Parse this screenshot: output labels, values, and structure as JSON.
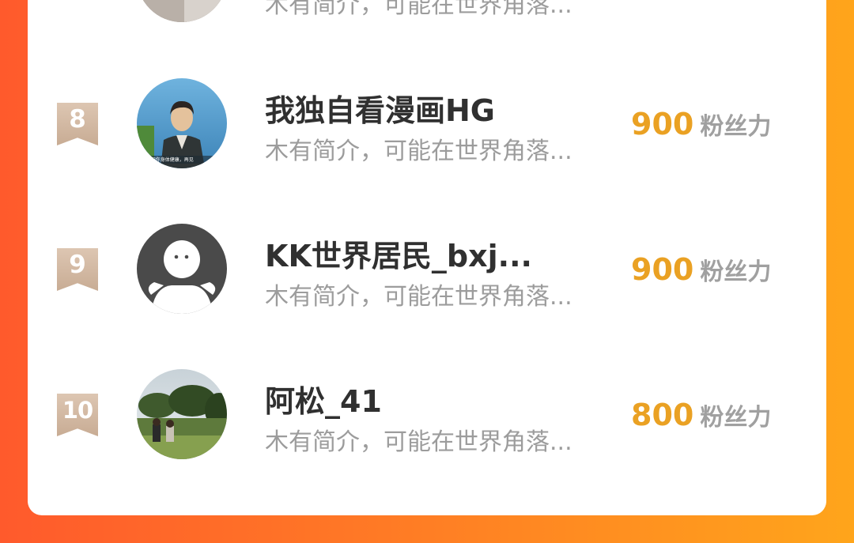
{
  "colors": {
    "accent_gradient_left": "#ff5a2c",
    "accent_gradient_right": "#ffa51b",
    "score": "#eaa123"
  },
  "top_partial": {
    "desc": "木有简介，可能在世界角落..."
  },
  "items": [
    {
      "rank": "8",
      "name": "我独自看漫画HG",
      "desc": "木有简介，可能在世界角落...",
      "score": "900",
      "unit": "粉丝力",
      "avatar_caption": "...祝你身体健康，再见"
    },
    {
      "rank": "9",
      "name": "KK世界居民_bxj...",
      "desc": "木有简介，可能在世界角落...",
      "score": "900",
      "unit": "粉丝力"
    },
    {
      "rank": "10",
      "name": "阿松_41",
      "desc": "木有简介，可能在世界角落...",
      "score": "800",
      "unit": "粉丝力"
    }
  ]
}
